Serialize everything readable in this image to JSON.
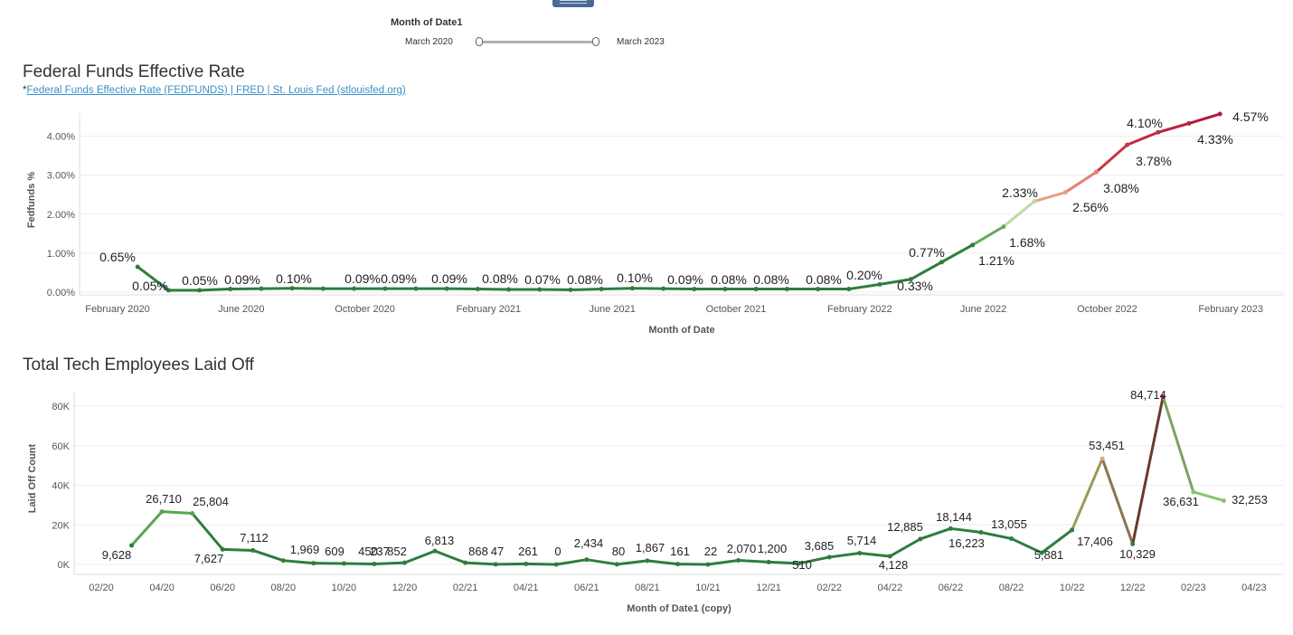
{
  "filter": {
    "title": "Month of Date1",
    "min_label": "March 2020",
    "max_label": "March 2023"
  },
  "fed": {
    "title": "Federal Funds Effective Rate",
    "source_prefix": "*",
    "source_link": "Federal Funds Effective Rate (FEDFUNDS) | FRED | St. Louis Fed (stlouisfed.org)"
  },
  "layoff": {
    "title": "Total Tech Employees Laid Off"
  },
  "chart_data": [
    {
      "type": "line",
      "title": "Federal Funds Effective Rate",
      "xlabel": "Month of Date",
      "ylabel": "Fedfunds %",
      "ylim": [
        0,
        4.8
      ],
      "y_ticks": [
        "0.00%",
        "1.00%",
        "2.00%",
        "3.00%",
        "4.00%"
      ],
      "x_tick_labels": [
        "February 2020",
        "June 2020",
        "October 2020",
        "February 2021",
        "June 2021",
        "October 2021",
        "February 2022",
        "June 2022",
        "October 2022",
        "February 2023"
      ],
      "x": [
        "2020-03",
        "2020-04",
        "2020-05",
        "2020-06",
        "2020-07",
        "2020-08",
        "2020-09",
        "2020-10",
        "2020-11",
        "2020-12",
        "2021-01",
        "2021-02",
        "2021-03",
        "2021-04",
        "2021-05",
        "2021-06",
        "2021-07",
        "2021-08",
        "2021-09",
        "2021-10",
        "2021-11",
        "2021-12",
        "2022-01",
        "2022-02",
        "2022-03",
        "2022-04",
        "2022-05",
        "2022-06",
        "2022-07",
        "2022-08",
        "2022-09",
        "2022-10",
        "2022-11",
        "2022-12",
        "2023-01",
        "2023-02",
        "2023-03"
      ],
      "values": [
        0.65,
        0.05,
        0.05,
        0.08,
        0.09,
        0.1,
        0.09,
        0.09,
        0.09,
        0.09,
        0.09,
        0.08,
        0.07,
        0.07,
        0.06,
        0.08,
        0.1,
        0.09,
        0.08,
        0.08,
        0.08,
        0.08,
        0.08,
        0.08,
        0.2,
        0.33,
        0.77,
        1.21,
        1.68,
        2.33,
        2.56,
        3.08,
        3.78,
        4.1,
        4.33,
        4.57,
        4.57
      ],
      "labels": [
        "0.65%",
        "0.05%",
        "0.05%",
        "0.09%",
        "0.10%",
        "0.09%",
        "0.09%",
        "0.09%",
        "0.08%",
        "0.07%",
        "0.08%",
        "0.10%",
        "0.09%",
        "0.08%",
        "0.08%",
        "0.08%",
        "0.20%",
        "0.33%",
        "0.77%",
        "1.21%",
        "1.68%",
        "2.33%",
        "2.56%",
        "3.08%",
        "3.78%",
        "4.10%",
        "4.33%",
        "4.57%"
      ],
      "colors": {
        "low": "#2e7d3e",
        "mid": "#c7dfa8",
        "high": "#b01c3c"
      }
    },
    {
      "type": "line",
      "title": "Total Tech Employees Laid Off",
      "xlabel": "Month of Date1 (copy)",
      "ylabel": "Laid Off Count",
      "ylim": [
        0,
        88000
      ],
      "y_ticks": [
        "0K",
        "20K",
        "40K",
        "60K",
        "80K"
      ],
      "x_tick_labels": [
        "02/20",
        "04/20",
        "06/20",
        "08/20",
        "10/20",
        "12/20",
        "02/21",
        "04/21",
        "06/21",
        "08/21",
        "10/21",
        "12/21",
        "02/22",
        "04/22",
        "06/22",
        "08/22",
        "10/22",
        "12/22",
        "02/23",
        "04/23"
      ],
      "x": [
        "2020-03",
        "2020-04",
        "2020-05",
        "2020-06",
        "2020-07",
        "2020-08",
        "2020-09",
        "2020-10",
        "2020-11",
        "2020-12",
        "2021-01",
        "2021-02",
        "2021-03",
        "2021-04",
        "2021-05",
        "2021-06",
        "2021-07",
        "2021-08",
        "2021-09",
        "2021-10",
        "2021-11",
        "2021-12",
        "2022-01",
        "2022-02",
        "2022-03",
        "2022-04",
        "2022-05",
        "2022-06",
        "2022-07",
        "2022-08",
        "2022-09",
        "2022-10",
        "2022-11",
        "2022-12",
        "2023-01",
        "2023-02",
        "2023-03"
      ],
      "values": [
        9628,
        26710,
        25804,
        7627,
        7112,
        1969,
        609,
        450,
        237,
        852,
        6813,
        868,
        47,
        261,
        0,
        2434,
        80,
        1867,
        161,
        22,
        2070,
        1200,
        510,
        3685,
        5714,
        4128,
        12885,
        18144,
        16223,
        13055,
        5881,
        17406,
        53451,
        10329,
        84714,
        36631,
        32253
      ],
      "labels": [
        "9,628",
        "26,710",
        "25,804",
        "7,627",
        "7,112",
        "1,969",
        "609",
        "450",
        "237",
        "852",
        "6,813",
        "868",
        "47",
        "261",
        "0",
        "2,434",
        "80",
        "1,867",
        "161",
        "22",
        "2,070",
        "1,200",
        "510",
        "3,685",
        "5,714",
        "4,128",
        "12,885",
        "18,144",
        "16,223",
        "13,055",
        "5,881",
        "17,406",
        "53,451",
        "10,329",
        "84,714",
        "36,631",
        "32,253"
      ],
      "colors": {
        "low": "#2e7d3e",
        "mid": "#e8a083",
        "high": "#b01c3c",
        "light": "#8cc46e"
      }
    }
  ]
}
